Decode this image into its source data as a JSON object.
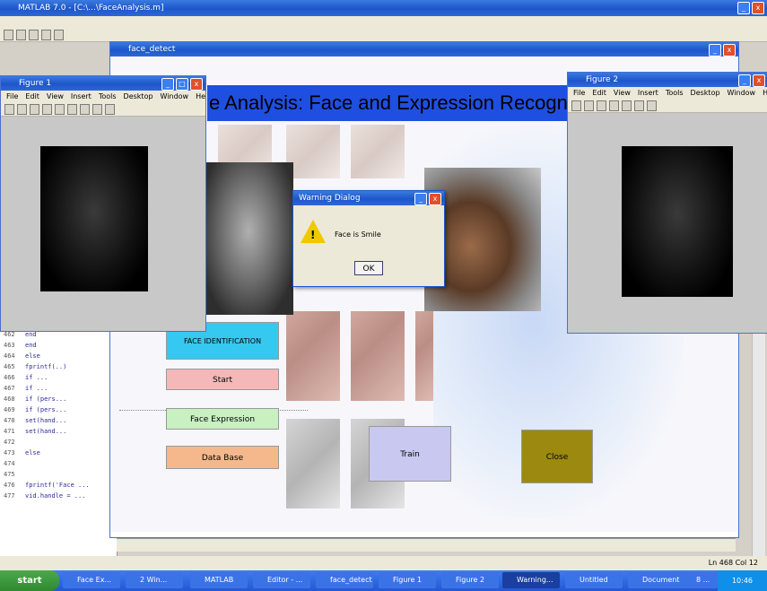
{
  "main_window": {
    "title": "MATLAB 7.0 - [C:\\...\\FaceAnalysis.m]"
  },
  "editor": {
    "line_numbers": [
      "462",
      "463",
      "464",
      "465",
      "466",
      "467",
      "468",
      "469",
      "470",
      "471",
      "472",
      "473",
      "474",
      "475",
      "476",
      "477"
    ],
    "code_lines": [
      "end",
      "end",
      "else",
      "fprintf(..)",
      "if ...",
      "if ...",
      "if (pers...",
      "if (pers...",
      "set(hand...",
      "set(hand...",
      "",
      "else",
      "",
      "",
      "fprintf('Face ...",
      "vid.handle = ..."
    ],
    "status": "Ln 468   Col 12"
  },
  "gui_window": {
    "title": "face_detect",
    "banner": "e Analysis: Face and Expression Recogni"
  },
  "left_figure": {
    "title": "Figure 1",
    "menu": [
      "File",
      "Edit",
      "View",
      "Insert",
      "Tools",
      "Desktop",
      "Window",
      "Help"
    ]
  },
  "right_figure": {
    "title": "Figure 2",
    "menu": [
      "File",
      "Edit",
      "View",
      "Insert",
      "Tools",
      "Desktop",
      "Window",
      "Help"
    ]
  },
  "buttons": {
    "face_identification": "FACE IDENTIFICATION",
    "start": "Start",
    "face_expression": "Face Expression",
    "data_base": "Data Base",
    "train": "Train",
    "close": "Close"
  },
  "dialog": {
    "title": "Warning Dialog",
    "message": "Face is Smile",
    "ok": "OK"
  },
  "taskbar": {
    "start": "start",
    "items": [
      "Face Ex...",
      "2 Win...",
      "MATLAB",
      "Editor - ...",
      "face_detect",
      "Figure 1",
      "Figure 2",
      "Warning...",
      "Untitled",
      "Document",
      "8 ..."
    ],
    "clock": "10:46"
  },
  "colors": {
    "banner_bg": "#1f4fe0",
    "face_id_bg": "#35c8f0",
    "start_bg": "#f4b8b8",
    "expr_bg": "#c8f0c0",
    "db_bg": "#f4b88c",
    "train_bg": "#c8c8f0",
    "close_bg": "#9c8a10"
  }
}
